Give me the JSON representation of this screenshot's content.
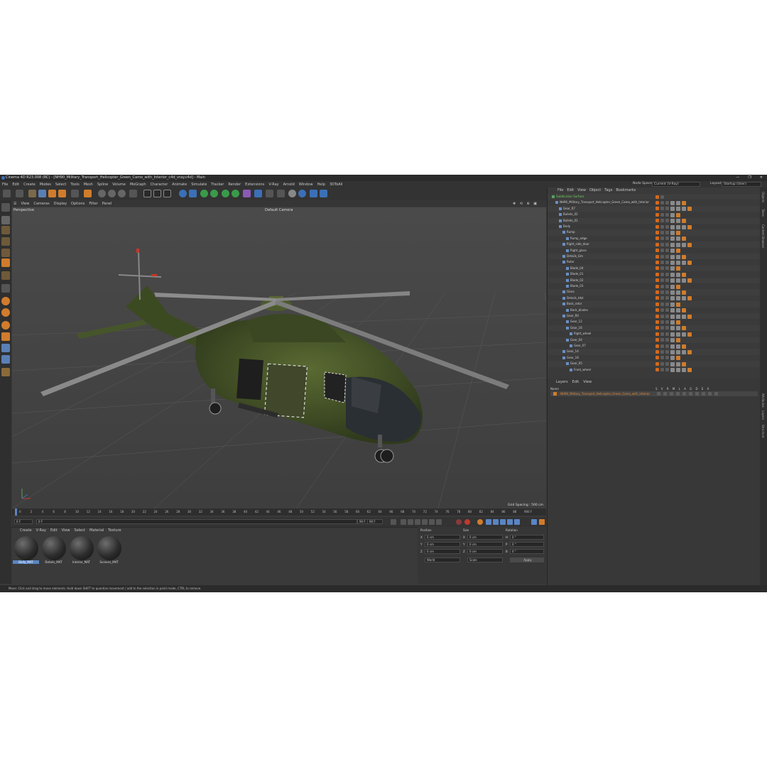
{
  "window": {
    "title": "Cinema 4D R23.008 (RC) - [NH90_Military_Transport_Helicopter_Green_Camo_with_Interior_c4d_vray.c4d] - Main",
    "controls": [
      "—",
      "❐",
      "✕"
    ]
  },
  "menubar": {
    "items": [
      "File",
      "Edit",
      "Create",
      "Modes",
      "Select",
      "Tools",
      "Mesh",
      "Spline",
      "Volume",
      "MoGraph",
      "Character",
      "Animate",
      "Simulate",
      "Tracker",
      "Render",
      "Extensions",
      "V-Ray",
      "Arnold",
      "Window",
      "Help",
      "3DToAll"
    ],
    "node_space_label": "Node Space:",
    "node_space_value": "Current (V-Ray)",
    "layout_label": "Layout:",
    "layout_value": "Startup (User)"
  },
  "viewport": {
    "menu": [
      "View",
      "Cameras",
      "Display",
      "Options",
      "Filter",
      "Panel"
    ],
    "label": "Perspective",
    "camera": "Default Camera",
    "grid_spacing": "Grid Spacing : 500 cm"
  },
  "timeline": {
    "ticks": [
      "0",
      "2",
      "4",
      "6",
      "8",
      "10",
      "12",
      "14",
      "16",
      "18",
      "20",
      "22",
      "24",
      "26",
      "28",
      "30",
      "32",
      "34",
      "36",
      "38",
      "40",
      "42",
      "44",
      "46",
      "48",
      "50",
      "52",
      "54",
      "56",
      "58",
      "60",
      "62",
      "64",
      "66",
      "68",
      "70",
      "72",
      "74",
      "76",
      "78",
      "80",
      "82",
      "84",
      "86",
      "88",
      "90"
    ],
    "end_frame": "0 F"
  },
  "transport": {
    "start": "0 F",
    "current": "0 F",
    "end": "90 F",
    "max": "90 F"
  },
  "material_manager": {
    "menu": [
      "Create",
      "V-Ray",
      "Edit",
      "View",
      "Select",
      "Material",
      "Texture"
    ],
    "materials": [
      "Body_MAT",
      "Details_MAT",
      "Interior_MAT",
      "Screens_MAT"
    ],
    "selected_index": 0
  },
  "attributes": {
    "rows": [
      {
        "a": "X",
        "av": "0 cm",
        "b": "X",
        "bv": "0 cm",
        "c": "H",
        "cv": "0 °"
      },
      {
        "a": "Y",
        "av": "0 cm",
        "b": "Y",
        "bv": "0 cm",
        "c": "P",
        "cv": "0 °"
      },
      {
        "a": "Z",
        "av": "0 cm",
        "b": "Z",
        "bv": "0 cm",
        "c": "B",
        "cv": "0 °"
      }
    ],
    "mode1": "World",
    "mode2": "Scale",
    "apply": "Apply",
    "headers": [
      "Position",
      "Size",
      "Rotation"
    ]
  },
  "object_manager": {
    "menu": [
      "File",
      "Edit",
      "View",
      "Object",
      "Tags",
      "Bookmarks"
    ],
    "objects": [
      {
        "name": "Subdivision Surface",
        "depth": 0,
        "green": true
      },
      {
        "name": "NH90_Military_Transport_Helicopter_Green_Camo_with_Interior",
        "depth": 1
      },
      {
        "name": "Gear_R7",
        "depth": 2
      },
      {
        "name": "Bullets_02",
        "depth": 2
      },
      {
        "name": "Bullets_01",
        "depth": 2
      },
      {
        "name": "Body",
        "depth": 2
      },
      {
        "name": "Rump",
        "depth": 3
      },
      {
        "name": "Rump_edge",
        "depth": 4
      },
      {
        "name": "Right_side_door",
        "depth": 3
      },
      {
        "name": "Right_glass",
        "depth": 4
      },
      {
        "name": "Details_Gm",
        "depth": 3
      },
      {
        "name": "Rotor",
        "depth": 3
      },
      {
        "name": "Blade_04",
        "depth": 4
      },
      {
        "name": "Blade_01",
        "depth": 4
      },
      {
        "name": "Blade_02",
        "depth": 4
      },
      {
        "name": "Blade_03",
        "depth": 4
      },
      {
        "name": "Glass",
        "depth": 3
      },
      {
        "name": "Details_tdol",
        "depth": 3
      },
      {
        "name": "Back_rotor",
        "depth": 3
      },
      {
        "name": "Back_blades",
        "depth": 4
      },
      {
        "name": "Gear_R0",
        "depth": 3
      },
      {
        "name": "Gear_12",
        "depth": 4
      },
      {
        "name": "Gear_16",
        "depth": 4
      },
      {
        "name": "Right_wheel",
        "depth": 5
      },
      {
        "name": "Gear_04",
        "depth": 4
      },
      {
        "name": "Gear_07",
        "depth": 5
      },
      {
        "name": "Gear_14",
        "depth": 3
      },
      {
        "name": "Gear_18",
        "depth": 3
      },
      {
        "name": "Gear_05",
        "depth": 4
      },
      {
        "name": "Front_wheel",
        "depth": 5
      }
    ]
  },
  "layers": {
    "menu": [
      "Layers",
      "Edit",
      "View"
    ],
    "column_name": "Name",
    "columns": "S V R M L A G D E X",
    "row": "NH90_Military_Transport_Helicopter_Green_Camo_with_Interior"
  },
  "status": {
    "text": "Move: Click and drag to move elements. Hold down SHIFT to quantize movement / add to the selection in point mode, CTRL to remove."
  },
  "side_tabs": [
    "Objects",
    "Takes",
    "Content Browser",
    "Attributes",
    "Layers",
    "Structure"
  ]
}
